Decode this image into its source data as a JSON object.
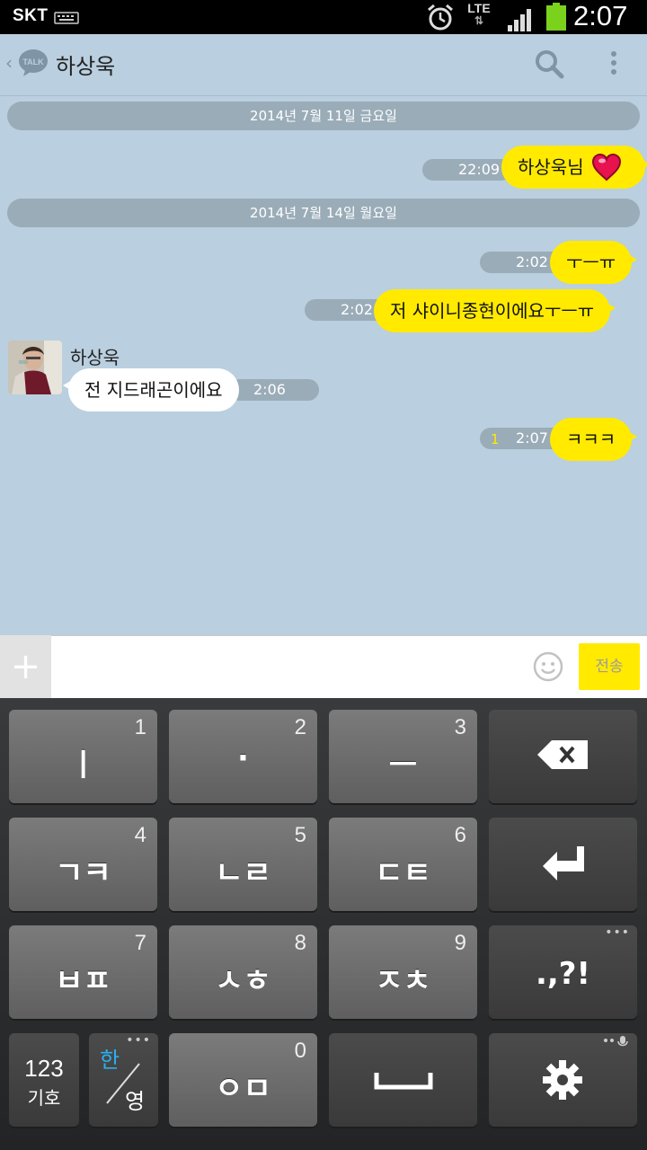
{
  "status_bar": {
    "carrier": "SKT",
    "network": "LTE",
    "network_arrows": "⇅",
    "time": "2:07",
    "battery_color": "#7bd21c"
  },
  "header": {
    "talk_logo": "TALK",
    "title": "하상욱"
  },
  "chat": {
    "date_dividers": [
      "2014년 7월 11일 금요일",
      "2014년 7월 14일 월요일"
    ],
    "messages": [
      {
        "direction": "out",
        "time": "22:09",
        "text": "하상욱님",
        "emoji": "heart-icon"
      },
      {
        "direction": "out",
        "time": "2:02",
        "text": "ㅜㅡㅠ"
      },
      {
        "direction": "out",
        "time": "2:02",
        "text": "저 샤이니종현이에요ㅜㅡㅠ"
      },
      {
        "direction": "in",
        "sender": "하상욱",
        "time": "2:06",
        "text": "전 지드래곤이에요"
      },
      {
        "direction": "out",
        "time": "2:07",
        "unread": "1",
        "text": "ㅋㅋㅋ"
      }
    ]
  },
  "input_bar": {
    "plus": "+",
    "placeholder": "",
    "send_label": "전송",
    "accent": "#ffea00"
  },
  "keyboard": {
    "keys": [
      {
        "main": "ㅣ",
        "num": "1"
      },
      {
        "main": "·",
        "num": "2"
      },
      {
        "main": "ㅡ",
        "num": "3"
      },
      {
        "main": "ㄱㅋ",
        "num": "4"
      },
      {
        "main": "ㄴㄹ",
        "num": "5"
      },
      {
        "main": "ㄷㅌ",
        "num": "6"
      },
      {
        "main": "ㅂㅍ",
        "num": "7"
      },
      {
        "main": "ㅅㅎ",
        "num": "8"
      },
      {
        "main": "ㅈㅊ",
        "num": "9"
      },
      {
        "main": ".,?!",
        "num": ""
      },
      {
        "main": "ㅇㅁ",
        "num": "0"
      }
    ],
    "mode_key": {
      "line1": "123",
      "line2": "기호"
    },
    "lang_key": {
      "han": "한",
      "eng": "영"
    },
    "han_color": "#2ab0f0"
  }
}
